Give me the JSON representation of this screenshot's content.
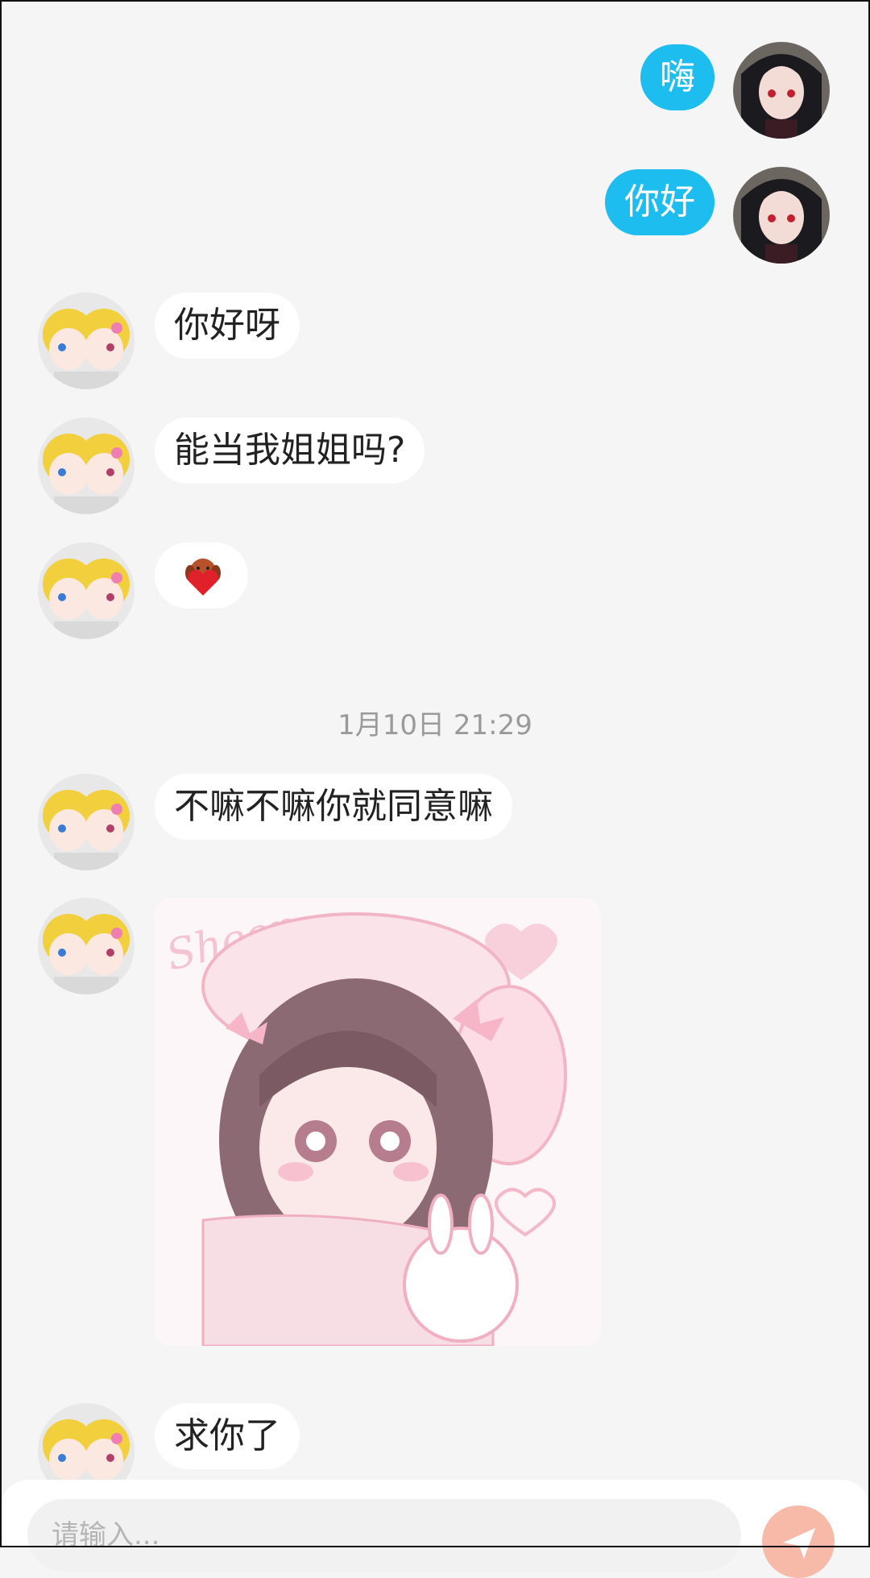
{
  "messages": [
    {
      "text": "嗨"
    },
    {
      "text": "你好"
    },
    {
      "text": "你好呀"
    },
    {
      "text": "能当我姐姐吗?"
    },
    {
      "emoji": "heart-emoji-sticker"
    },
    {
      "text": "不嘛不嘛你就同意嘛"
    },
    {
      "image": "pink-anime-girl-bunny-sticker",
      "image_text": "Sheep"
    },
    {
      "text": "求你了"
    }
  ],
  "timestamp": "1月10日 21:29",
  "input": {
    "placeholder": "请输入..."
  },
  "colors": {
    "outgoing_bubble": "#1dbdf0",
    "incoming_bubble": "#ffffff",
    "background": "#f5f5f5",
    "send_button": "#f7b9a8"
  },
  "icons": {
    "send": "send-arrow-icon"
  }
}
